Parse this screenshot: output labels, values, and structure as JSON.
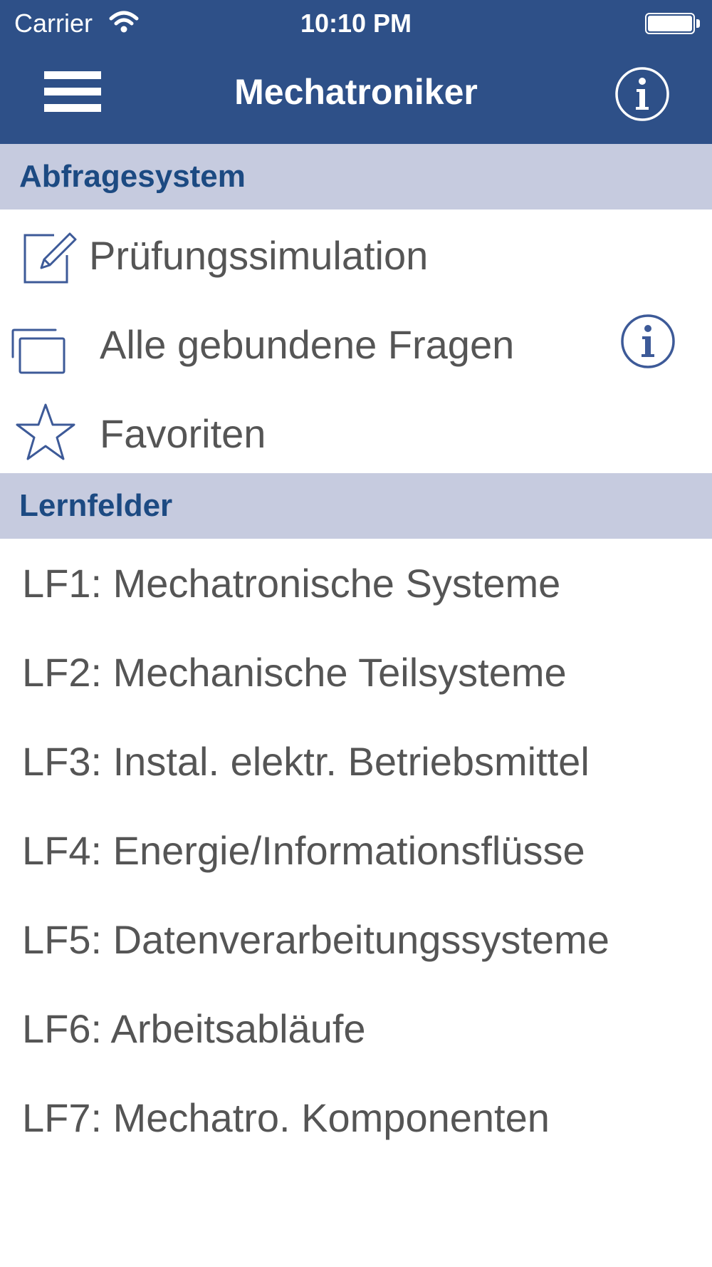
{
  "status_bar": {
    "carrier": "Carrier",
    "time": "10:10 PM",
    "wifi_icon": "wifi-icon",
    "battery_icon": "battery-icon"
  },
  "nav": {
    "title": "Mechatroniker",
    "menu_icon": "hamburger-menu-icon",
    "info_icon": "info-icon",
    "background_color": "#2e5088"
  },
  "sections": {
    "abfrage": {
      "header": "Abfragesystem",
      "items": [
        {
          "label": "Prüfungssimulation",
          "icon": "edit-icon"
        },
        {
          "label": "Alle gebundene Fragen",
          "icon": "stacked-cards-icon",
          "accessory_icon": "info-icon"
        },
        {
          "label": "Favoriten",
          "icon": "star-icon"
        }
      ]
    },
    "lernfelder": {
      "header": "Lernfelder",
      "items": [
        {
          "label": "LF1: Mechatronische Systeme"
        },
        {
          "label": "LF2: Mechanische Teilsysteme"
        },
        {
          "label": "LF3: Instal. elektr. Betriebsmittel"
        },
        {
          "label": "LF4: Energie/Informationsflüsse"
        },
        {
          "label": "LF5: Datenverarbeitungssysteme"
        },
        {
          "label": "LF6: Arbeitsabläufe"
        },
        {
          "label": "LF7: Mechatro. Komponenten"
        }
      ]
    }
  },
  "colors": {
    "section_header_bg": "#c6cbdf",
    "section_header_text": "#1c4a82",
    "row_text": "#555555",
    "icon_color": "#3d5a98"
  }
}
